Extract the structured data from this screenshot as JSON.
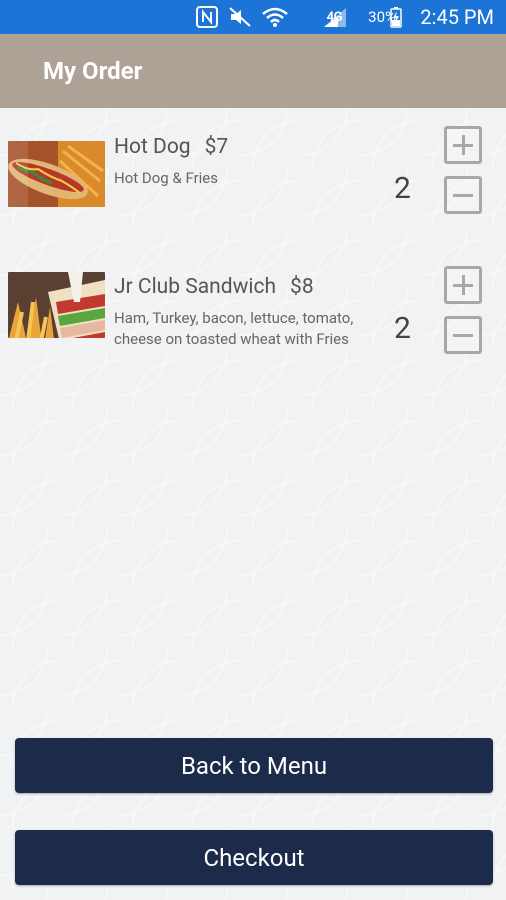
{
  "status_bar": {
    "network": "4G",
    "battery": "30%",
    "time": "2:45 PM"
  },
  "app_bar": {
    "title": "My Order"
  },
  "order": {
    "items": [
      {
        "name": "Hot Dog",
        "price": "$7",
        "description": "Hot Dog & Fries",
        "quantity": "2",
        "image": "hot-dog-photo"
      },
      {
        "name": "Jr Club Sandwich",
        "price": "$8",
        "description": "Ham, Turkey, bacon, lettuce, tomato, cheese on toasted wheat with Fries",
        "quantity": "2",
        "image": "club-sandwich-photo"
      }
    ]
  },
  "actions": {
    "back_label": "Back to Menu",
    "checkout_label": "Checkout"
  },
  "colors": {
    "status_bar": "#1b74d6",
    "app_bar": "#aea297",
    "button": "#1c2b4a"
  }
}
